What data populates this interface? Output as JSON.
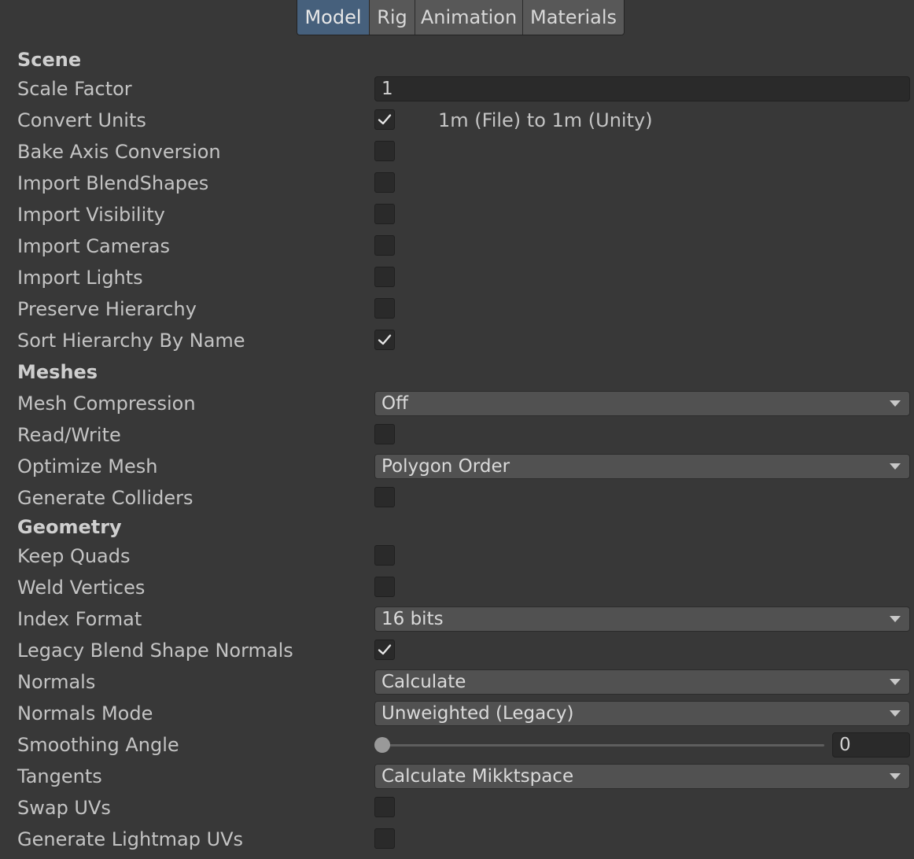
{
  "tabs": [
    {
      "label": "Model",
      "active": true
    },
    {
      "label": "Rig",
      "active": false
    },
    {
      "label": "Animation",
      "active": false
    },
    {
      "label": "Materials",
      "active": false
    }
  ],
  "scene": {
    "header": "Scene",
    "scale_factor": {
      "label": "Scale Factor",
      "value": "1"
    },
    "convert_units": {
      "label": "Convert Units",
      "checked": true,
      "info": "1m (File) to 1m (Unity)"
    },
    "bake_axis": {
      "label": "Bake Axis Conversion",
      "checked": false
    },
    "import_blendshapes": {
      "label": "Import BlendShapes",
      "checked": false
    },
    "import_visibility": {
      "label": "Import Visibility",
      "checked": false
    },
    "import_cameras": {
      "label": "Import Cameras",
      "checked": false
    },
    "import_lights": {
      "label": "Import Lights",
      "checked": false
    },
    "preserve_hierarchy": {
      "label": "Preserve Hierarchy",
      "checked": false
    },
    "sort_hierarchy": {
      "label": "Sort Hierarchy By Name",
      "checked": true
    }
  },
  "meshes": {
    "header": "Meshes",
    "mesh_compression": {
      "label": "Mesh Compression",
      "value": "Off"
    },
    "read_write": {
      "label": "Read/Write",
      "checked": false
    },
    "optimize_mesh": {
      "label": "Optimize Mesh",
      "value": "Polygon Order"
    },
    "generate_colliders": {
      "label": "Generate Colliders",
      "checked": false
    }
  },
  "geometry": {
    "header": "Geometry",
    "keep_quads": {
      "label": "Keep Quads",
      "checked": false
    },
    "weld_vertices": {
      "label": "Weld Vertices",
      "checked": false
    },
    "index_format": {
      "label": "Index Format",
      "value": "16 bits"
    },
    "legacy_blend": {
      "label": "Legacy Blend Shape Normals",
      "checked": true
    },
    "normals": {
      "label": "Normals",
      "value": "Calculate"
    },
    "normals_mode": {
      "label": "Normals Mode",
      "value": "Unweighted (Legacy)"
    },
    "smoothing_angle": {
      "label": "Smoothing Angle",
      "value": "0",
      "fraction": 0
    },
    "tangents": {
      "label": "Tangents",
      "value": "Calculate Mikktspace"
    },
    "swap_uvs": {
      "label": "Swap UVs",
      "checked": false
    },
    "lightmap_uvs": {
      "label": "Generate Lightmap UVs",
      "checked": false
    }
  },
  "icons": {
    "check": "checkmark-icon",
    "dropdown": "chevron-down-icon"
  },
  "colors": {
    "active_tab": "#46607c",
    "background": "#383838"
  }
}
